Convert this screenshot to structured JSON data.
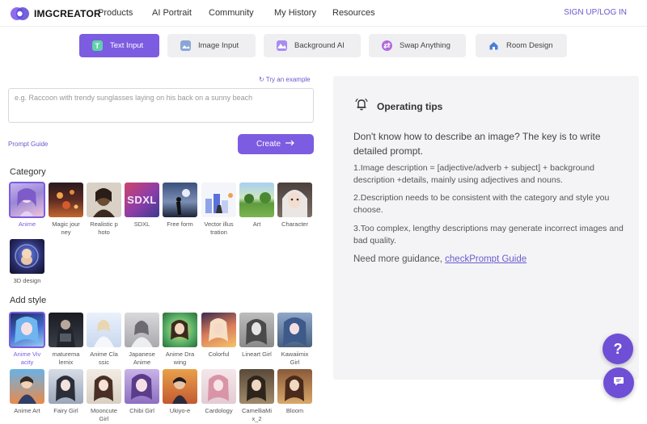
{
  "brand": {
    "name": "IMGCREATOR"
  },
  "nav": {
    "items": [
      "Products",
      "AI Portrait",
      "Community",
      "My History",
      "Resources"
    ],
    "signup": "SIGN UP/LOG IN"
  },
  "tabs": [
    {
      "label": "Text Input",
      "icon": "text-input-icon",
      "active": true
    },
    {
      "label": "Image Input",
      "icon": "image-input-icon",
      "active": false
    },
    {
      "label": "Background AI",
      "icon": "background-ai-icon",
      "active": false
    },
    {
      "label": "Swap Anything",
      "icon": "swap-anything-icon",
      "active": false
    },
    {
      "label": "Room Design",
      "icon": "room-design-icon",
      "active": false
    }
  ],
  "prompt": {
    "try_example": "Try an example",
    "placeholder": "e.g. Raccoon with trendy sunglasses laying on his back on a sunny beach",
    "guide_link": "Prompt Guide",
    "create_label": "Create"
  },
  "category": {
    "title": "Category",
    "items": [
      {
        "label": "Anime",
        "selected": true
      },
      {
        "label": "Magic jour ney",
        "selected": false
      },
      {
        "label": "Realistic p hoto",
        "selected": false
      },
      {
        "label": "SDXL",
        "selected": false
      },
      {
        "label": "Free form",
        "selected": false
      },
      {
        "label": "Vector illus tration",
        "selected": false
      },
      {
        "label": "Art",
        "selected": false
      },
      {
        "label": "Character",
        "selected": false
      },
      {
        "label": "3D design",
        "selected": false
      }
    ],
    "sdxl_text": "SDXL"
  },
  "style": {
    "title": "Add style",
    "items": [
      {
        "label": "Anime Viv acity",
        "selected": true
      },
      {
        "label": "maturema lemix",
        "selected": false
      },
      {
        "label": "Anime Cla ssic",
        "selected": false
      },
      {
        "label": "Japanese Anime",
        "selected": false
      },
      {
        "label": "Anime Dra wing",
        "selected": false
      },
      {
        "label": "Colorful",
        "selected": false
      },
      {
        "label": "Lineart Girl",
        "selected": false
      },
      {
        "label": "Kawaiimix Girl",
        "selected": false
      },
      {
        "label": "Anime Art",
        "selected": false
      },
      {
        "label": "Fairy Girl",
        "selected": false
      },
      {
        "label": "Mooncute Girl",
        "selected": false
      },
      {
        "label": "Chibi Girl",
        "selected": false
      },
      {
        "label": "Ukiyo-e",
        "selected": false
      },
      {
        "label": "Cardology",
        "selected": false
      },
      {
        "label": "CamelliaMi x_2",
        "selected": false
      },
      {
        "label": "Bloom",
        "selected": false
      }
    ]
  },
  "tips": {
    "title": "Operating tips",
    "lead": "Don't know how to describe an image? The key is to write detailed prompt.",
    "items": [
      "1.Image description = [adjective/adverb + subject] + background description +details, mainly using adjectives and nouns.",
      "2.Description needs to be consistent with the category and style you choose.",
      "3.Too complex, lengthy descriptions may generate incorrect images and bad quality."
    ],
    "guidance_prefix": "Need more guidance, ",
    "guidance_link": "checkPrompt Guide"
  },
  "colors": {
    "accent": "#7c5ce0",
    "fab": "#6e4fd6",
    "link": "#6a5acd",
    "panel": "#f4f4f6"
  }
}
